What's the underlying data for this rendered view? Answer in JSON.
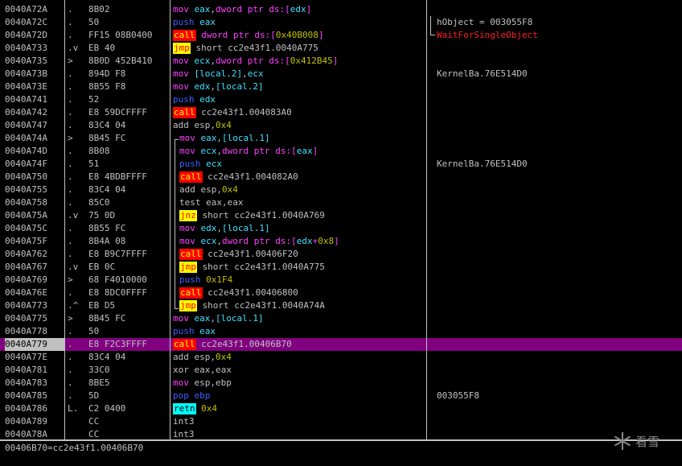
{
  "rows": [
    {
      "addr": "0040A72A",
      "mark": ".",
      "bytes": "8B02",
      "dis": [
        {
          "t": "mov",
          "c": "mov"
        },
        {
          "t": " "
        },
        {
          "t": "eax",
          "c": "reg"
        },
        {
          "t": ","
        },
        {
          "t": "dword ptr ds:[",
          "c": "ptr"
        },
        {
          "t": "edx",
          "c": "reg"
        },
        {
          "t": "]",
          "c": "ptr"
        }
      ],
      "com": "",
      "com_red": false
    },
    {
      "addr": "0040A72C",
      "mark": ".",
      "bytes": "50",
      "dis": [
        {
          "t": "push",
          "c": "push"
        },
        {
          "t": " "
        },
        {
          "t": "eax",
          "c": "reg"
        }
      ],
      "com": "hObject = 003055F8",
      "com_red": false
    },
    {
      "addr": "0040A72D",
      "mark": ".",
      "bytes": "FF15 08B0400",
      "dis": [
        {
          "t": "call",
          "m": "call"
        },
        {
          "t": " "
        },
        {
          "t": "dword ptr ds:[",
          "c": "ptr"
        },
        {
          "t": "0x40B008",
          "c": "num"
        },
        {
          "t": "]",
          "c": "ptr"
        }
      ],
      "com": "WaitForSingleObject",
      "com_red": true
    },
    {
      "addr": "0040A733",
      "mark": ".v",
      "bytes": "EB 40",
      "dis": [
        {
          "t": "jmp",
          "m": "jmp"
        },
        {
          "t": " short cc2e43f1.0040A775"
        }
      ],
      "com": "",
      "com_red": false
    },
    {
      "addr": "0040A735",
      "mark": ">",
      "bytes": "8B0D 452B410",
      "dis": [
        {
          "t": "mov",
          "c": "mov"
        },
        {
          "t": " "
        },
        {
          "t": "ecx",
          "c": "reg"
        },
        {
          "t": ","
        },
        {
          "t": "dword ptr ds:[",
          "c": "ptr"
        },
        {
          "t": "0x412B45",
          "c": "num"
        },
        {
          "t": "]",
          "c": "ptr"
        }
      ],
      "com": "",
      "com_red": false
    },
    {
      "addr": "0040A73B",
      "mark": ".",
      "bytes": "894D F8",
      "dis": [
        {
          "t": "mov",
          "c": "mov"
        },
        {
          "t": " "
        },
        {
          "t": "[local.2]",
          "c": "reg"
        },
        {
          "t": ","
        },
        {
          "t": "ecx",
          "c": "reg"
        }
      ],
      "com": "KernelBa.76E514D0",
      "com_red": false
    },
    {
      "addr": "0040A73E",
      "mark": ".",
      "bytes": "8B55 F8",
      "dis": [
        {
          "t": "mov",
          "c": "mov"
        },
        {
          "t": " "
        },
        {
          "t": "edx",
          "c": "reg"
        },
        {
          "t": ","
        },
        {
          "t": "[local.2]",
          "c": "reg"
        }
      ],
      "com": "",
      "com_red": false
    },
    {
      "addr": "0040A741",
      "mark": ".",
      "bytes": "52",
      "dis": [
        {
          "t": "push",
          "c": "push"
        },
        {
          "t": " "
        },
        {
          "t": "edx",
          "c": "reg"
        }
      ],
      "com": "",
      "com_red": false
    },
    {
      "addr": "0040A742",
      "mark": ".",
      "bytes": "E8 59DCFFFF",
      "dis": [
        {
          "t": "call",
          "m": "call"
        },
        {
          "t": " cc2e43f1.004083A0"
        }
      ],
      "com": "",
      "com_red": false
    },
    {
      "addr": "0040A747",
      "mark": ".",
      "bytes": "83C4 04",
      "dis": [
        {
          "t": "add esp,"
        },
        {
          "t": "0x4",
          "c": "num"
        }
      ],
      "com": "",
      "com_red": false
    },
    {
      "addr": "0040A74A",
      "mark": ">",
      "bytes": "8B45 FC",
      "dis": [
        {
          "t": "mov",
          "c": "mov"
        },
        {
          "t": " "
        },
        {
          "t": "eax",
          "c": "reg"
        },
        {
          "t": ","
        },
        {
          "t": "[local.1]",
          "c": "reg"
        }
      ],
      "com": "",
      "com_red": false,
      "indent": true
    },
    {
      "addr": "0040A74D",
      "mark": ".",
      "bytes": "8B08",
      "dis": [
        {
          "t": "mov",
          "c": "mov"
        },
        {
          "t": " "
        },
        {
          "t": "ecx",
          "c": "reg"
        },
        {
          "t": ","
        },
        {
          "t": "dword ptr ds:[",
          "c": "ptr"
        },
        {
          "t": "eax",
          "c": "reg"
        },
        {
          "t": "]",
          "c": "ptr"
        }
      ],
      "com": "",
      "com_red": false,
      "indent": true
    },
    {
      "addr": "0040A74F",
      "mark": ".",
      "bytes": "51",
      "dis": [
        {
          "t": "push",
          "c": "push"
        },
        {
          "t": " "
        },
        {
          "t": "ecx",
          "c": "reg"
        }
      ],
      "com": "KernelBa.76E514D0",
      "com_red": false,
      "indent": true
    },
    {
      "addr": "0040A750",
      "mark": ".",
      "bytes": "E8 4BDBFFFF",
      "dis": [
        {
          "t": "call",
          "m": "call"
        },
        {
          "t": " cc2e43f1.004082A0"
        }
      ],
      "com": "",
      "com_red": false,
      "indent": true
    },
    {
      "addr": "0040A755",
      "mark": ".",
      "bytes": "83C4 04",
      "dis": [
        {
          "t": "add esp,"
        },
        {
          "t": "0x4",
          "c": "num"
        }
      ],
      "com": "",
      "com_red": false,
      "indent": true
    },
    {
      "addr": "0040A758",
      "mark": ".",
      "bytes": "85C0",
      "dis": [
        {
          "t": "test eax,eax"
        }
      ],
      "com": "",
      "com_red": false,
      "indent": true
    },
    {
      "addr": "0040A75A",
      "mark": ".v",
      "bytes": "75 0D",
      "dis": [
        {
          "t": "jnz",
          "m": "jmp"
        },
        {
          "t": " short cc2e43f1.0040A769"
        }
      ],
      "com": "",
      "com_red": false,
      "indent": true
    },
    {
      "addr": "0040A75C",
      "mark": ".",
      "bytes": "8B55 FC",
      "dis": [
        {
          "t": "mov",
          "c": "mov"
        },
        {
          "t": " "
        },
        {
          "t": "edx",
          "c": "reg"
        },
        {
          "t": ","
        },
        {
          "t": "[local.1]",
          "c": "reg"
        }
      ],
      "com": "",
      "com_red": false,
      "indent": true
    },
    {
      "addr": "0040A75F",
      "mark": ".",
      "bytes": "8B4A 08",
      "dis": [
        {
          "t": "mov",
          "c": "mov"
        },
        {
          "t": " "
        },
        {
          "t": "ecx",
          "c": "reg"
        },
        {
          "t": ","
        },
        {
          "t": "dword ptr ds:[",
          "c": "ptr"
        },
        {
          "t": "edx",
          "c": "reg"
        },
        {
          "t": "+",
          "c": "ptr"
        },
        {
          "t": "0x8",
          "c": "num"
        },
        {
          "t": "]",
          "c": "ptr"
        }
      ],
      "com": "",
      "com_red": false,
      "indent": true
    },
    {
      "addr": "0040A762",
      "mark": ".",
      "bytes": "E8 B9C7FFFF",
      "dis": [
        {
          "t": "call",
          "m": "call"
        },
        {
          "t": " cc2e43f1.00406F20"
        }
      ],
      "com": "",
      "com_red": false,
      "indent": true
    },
    {
      "addr": "0040A767",
      "mark": ".v",
      "bytes": "EB 0C",
      "dis": [
        {
          "t": "jmp",
          "m": "jmp"
        },
        {
          "t": " short cc2e43f1.0040A775"
        }
      ],
      "com": "",
      "com_red": false,
      "indent": true
    },
    {
      "addr": "0040A769",
      "mark": ">",
      "bytes": "68 F4010000",
      "dis": [
        {
          "t": "push",
          "c": "push"
        },
        {
          "t": " "
        },
        {
          "t": "0x1F4",
          "c": "num"
        }
      ],
      "com": "",
      "com_red": false,
      "indent": true
    },
    {
      "addr": "0040A76E",
      "mark": ".",
      "bytes": "E8 8DC0FFFF",
      "dis": [
        {
          "t": "call",
          "m": "call"
        },
        {
          "t": " cc2e43f1.00406800"
        }
      ],
      "com": "",
      "com_red": false,
      "indent": true
    },
    {
      "addr": "0040A773",
      "mark": ".^",
      "bytes": "EB D5",
      "dis": [
        {
          "t": "jmp",
          "m": "jmp"
        },
        {
          "t": " short cc2e43f1.0040A74A"
        }
      ],
      "com": "",
      "com_red": false,
      "indent": true
    },
    {
      "addr": "0040A775",
      "mark": ">",
      "bytes": "8B45 FC",
      "dis": [
        {
          "t": "mov",
          "c": "mov"
        },
        {
          "t": " "
        },
        {
          "t": "eax",
          "c": "reg"
        },
        {
          "t": ","
        },
        {
          "t": "[local.1]",
          "c": "reg"
        }
      ],
      "com": "",
      "com_red": false
    },
    {
      "addr": "0040A778",
      "mark": ".",
      "bytes": "50",
      "dis": [
        {
          "t": "push",
          "c": "push"
        },
        {
          "t": " "
        },
        {
          "t": "eax",
          "c": "reg"
        }
      ],
      "com": "",
      "com_red": false
    },
    {
      "addr": "0040A779",
      "mark": ".",
      "bytes": "E8 F2C3FFFF",
      "dis": [
        {
          "t": "call",
          "m": "call"
        },
        {
          "t": " cc2e43f1.00406B70"
        }
      ],
      "com": "",
      "com_red": false,
      "selected": true
    },
    {
      "addr": "0040A77E",
      "mark": ".",
      "bytes": "83C4 04",
      "dis": [
        {
          "t": "add esp,"
        },
        {
          "t": "0x4",
          "c": "num"
        }
      ],
      "com": "",
      "com_red": false
    },
    {
      "addr": "0040A781",
      "mark": ".",
      "bytes": "33C0",
      "dis": [
        {
          "t": "xor eax,eax"
        }
      ],
      "com": "",
      "com_red": false
    },
    {
      "addr": "0040A783",
      "mark": ".",
      "bytes": "8BE5",
      "dis": [
        {
          "t": "mov",
          "c": "mov"
        },
        {
          "t": " esp,ebp"
        }
      ],
      "com": "",
      "com_red": false
    },
    {
      "addr": "0040A785",
      "mark": ".",
      "bytes": "5D",
      "dis": [
        {
          "t": "pop ebp",
          "c": "push"
        }
      ],
      "com": "003055F8",
      "com_red": false
    },
    {
      "addr": "0040A786",
      "mark": "L.",
      "bytes": "C2 0400",
      "dis": [
        {
          "t": "retn",
          "m": "retn"
        },
        {
          "t": " "
        },
        {
          "t": "0x4",
          "c": "num"
        }
      ],
      "com": "",
      "com_red": false
    },
    {
      "addr": "0040A789",
      "mark": "",
      "bytes": "CC",
      "dis": [
        {
          "t": "int3"
        }
      ],
      "com": "",
      "com_red": false
    },
    {
      "addr": "0040A78A",
      "mark": "",
      "bytes": "CC",
      "dis": [
        {
          "t": "int3"
        }
      ],
      "com": "",
      "com_red": false
    }
  ],
  "status": {
    "text": "00406B70=cc2e43f1.00406B70"
  },
  "watermark": {
    "text": "看雪"
  },
  "colors": {
    "selected_row": "#800080",
    "call_bg": "#ff0000",
    "jmp_bg": "#ffff00",
    "retn_bg": "#00ffff"
  }
}
